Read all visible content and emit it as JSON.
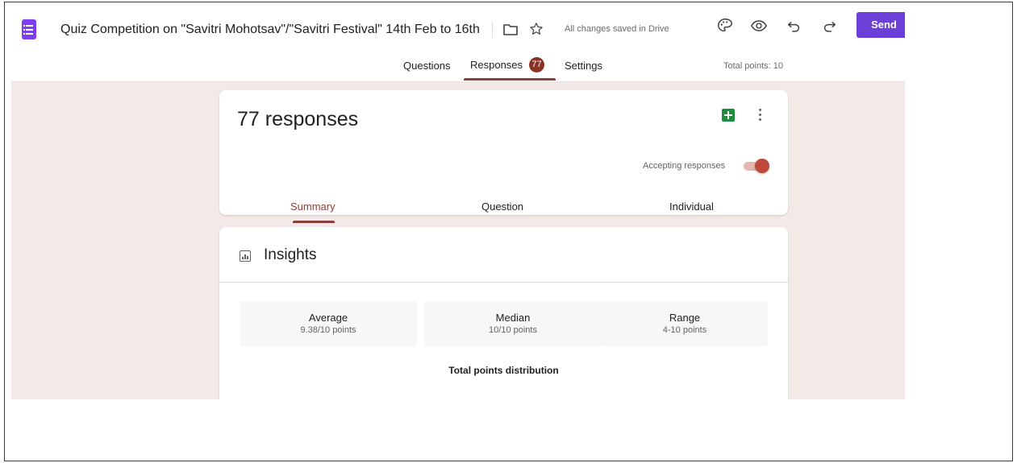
{
  "header": {
    "title": "Quiz Competition on \"Savitri Mohotsav\"/\"Savitri Festival\" 14th Feb to 16th",
    "save_status": "All changes saved in Drive",
    "send_label": "Send"
  },
  "tabs": {
    "questions": "Questions",
    "responses": "Responses",
    "responses_count": "77",
    "settings": "Settings",
    "total_points": "Total points: 10"
  },
  "responses_card": {
    "count_label": "77 responses",
    "accepting_label": "Accepting responses",
    "accepting_on": true,
    "subtabs": [
      "Summary",
      "Question",
      "Individual"
    ],
    "active_subtab": "Summary"
  },
  "insights": {
    "title": "Insights",
    "stats": [
      {
        "label": "Average",
        "value": "9.38/10 points"
      },
      {
        "label": "Median",
        "value": "10/10 points"
      },
      {
        "label": "Range",
        "value": "4-10 points"
      }
    ],
    "distribution_title": "Total points distribution"
  },
  "colors": {
    "accent": "#8a3f38",
    "send_button": "#6c3fd8",
    "form_icon": "#7e3ff2",
    "sheets_icon": "#1e8e3e",
    "background": "#f3eae8"
  },
  "icons": [
    "forms-icon",
    "folder-icon",
    "star-icon",
    "palette-icon",
    "preview-eye-icon",
    "undo-icon",
    "redo-icon",
    "sheets-icon",
    "more-vert-icon",
    "insights-chart-icon"
  ]
}
